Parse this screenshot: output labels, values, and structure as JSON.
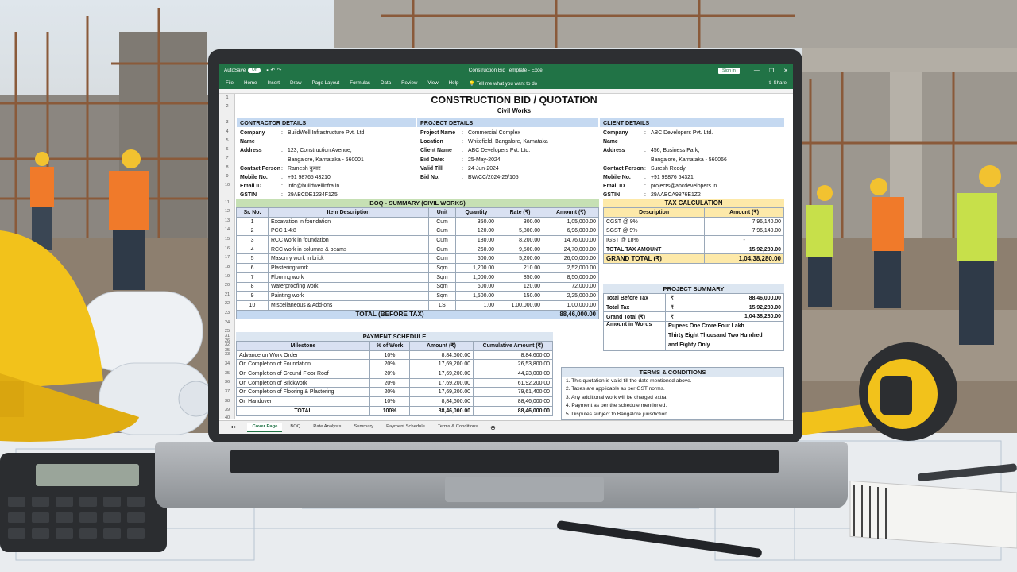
{
  "window": {
    "autosave_label": "AutoSave",
    "autosave_state": "On",
    "title": "Construction Bid Template - Excel",
    "signin_label": "Sign in",
    "minimize": "—",
    "restore": "❐",
    "close": "✕"
  },
  "ribbon": {
    "tabs": [
      "File",
      "Home",
      "Insert",
      "Draw",
      "Page Layout",
      "Formulas",
      "Data",
      "Review",
      "View",
      "Help"
    ],
    "tell_me": "Tell me what you want to do",
    "share": "Share"
  },
  "sheet": {
    "title": "CONSTRUCTION BID / QUOTATION",
    "subtitle": "Civil Works",
    "row_numbers": [
      "1",
      "2",
      "3",
      "4",
      "5",
      "6",
      "7",
      "8",
      "9",
      "10",
      "11",
      "12",
      "13",
      "14",
      "15",
      "16",
      "17",
      "18",
      "19",
      "20",
      "21",
      "22",
      "23",
      "24",
      "25",
      "26",
      "35",
      "31",
      "32",
      "33",
      "34",
      "35",
      "36",
      "37",
      "38",
      "39",
      "40"
    ],
    "contractor": {
      "header": "CONTRACTOR DETAILS",
      "fields": [
        {
          "k": "Company Name",
          "v": "BuildWell Infrastructure Pvt. Ltd."
        },
        {
          "k": "Address",
          "v": "123, Construction Avenue,"
        },
        {
          "k": "",
          "v": "Bangalore, Karnataka - 560001"
        },
        {
          "k": "Contact Person",
          "v": "Ramesh कुमार"
        },
        {
          "k": "Mobile No.",
          "v": "+91 98765 43210"
        },
        {
          "k": "Email ID",
          "v": "info@buildwellinfra.in"
        },
        {
          "k": "GSTIN",
          "v": "29ABCDE1234F1Z5"
        }
      ]
    },
    "project": {
      "header": "PROJECT DETAILS",
      "fields": [
        {
          "k": "Project Name",
          "v": "Commercial Complex"
        },
        {
          "k": "Location",
          "v": "Whitefield, Bangalore, Karnataka"
        },
        {
          "k": "",
          "v": ""
        },
        {
          "k": "Client Name",
          "v": "ABC Developers Pvt. Ltd."
        },
        {
          "k": "Bid Date:",
          "v": "25-May-2024"
        },
        {
          "k": "Valid Till",
          "v": "24-Jun-2024"
        },
        {
          "k": "Bid No.",
          "v": "BW/CC/2024-25/105"
        }
      ]
    },
    "client": {
      "header": "CLIENT DETAILS",
      "fields": [
        {
          "k": "Company Name",
          "v": "ABC Developers Pvt. Ltd."
        },
        {
          "k": "Address",
          "v": "456, Business Park,"
        },
        {
          "k": "",
          "v": "Bangalore, Karnataka - 560066"
        },
        {
          "k": "Contact Person",
          "v": "Suresh Reddy"
        },
        {
          "k": "Mobile No.",
          "v": "+91 99876 54321"
        },
        {
          "k": "Email ID",
          "v": "projects@abcdevelopers.in"
        },
        {
          "k": "GSTIN",
          "v": "29AABCA9876E1Z2"
        }
      ]
    },
    "boq": {
      "header": "BOQ - SUMMARY (CIVIL WORKS)",
      "columns": [
        "Sr. No.",
        "Item Description",
        "Unit",
        "Quantity",
        "Rate (₹)",
        "Amount (₹)"
      ],
      "rows": [
        [
          "1",
          "Excavation in foundation",
          "Cum",
          "350.00",
          "300.00",
          "1,05,000.00"
        ],
        [
          "2",
          "PCC 1:4:8",
          "Cum",
          "120.00",
          "5,800.00",
          "6,96,000.00"
        ],
        [
          "3",
          "RCC work in foundation",
          "Cum",
          "180.00",
          "8,200.00",
          "14,76,000.00"
        ],
        [
          "4",
          "RCC work in columns & beams",
          "Cum",
          "260.00",
          "9,500.00",
          "24,70,000.00"
        ],
        [
          "5",
          "Masonry work in brick",
          "Cum",
          "500.00",
          "5,200.00",
          "26,00,000.00"
        ],
        [
          "6",
          "Plastering work",
          "Sqm",
          "1,200.00",
          "210.00",
          "2,52,000.00"
        ],
        [
          "7",
          "Flooring work",
          "Sqm",
          "1,000.00",
          "850.00",
          "8,50,000.00"
        ],
        [
          "8",
          "Waterproofing work",
          "Sqm",
          "600.00",
          "120.00",
          "72,000.00"
        ],
        [
          "9",
          "Painting work",
          "Sqm",
          "1,500.00",
          "150.00",
          "2,25,000.00"
        ],
        [
          "10",
          "Miscellaneous & Add-ons",
          "LS",
          "1.00",
          "1,00,000.00",
          "1,00,000.00"
        ]
      ],
      "total_label": "TOTAL (BEFORE TAX)",
      "total_value": "88,46,000.00"
    },
    "tax": {
      "header": "TAX CALCULATION",
      "columns": [
        "Description",
        "Amount (₹)"
      ],
      "rows": [
        [
          "CGST @ 9%",
          "7,96,140.00"
        ],
        [
          "SGST @ 9%",
          "7,96,140.00"
        ],
        [
          "IGST @ 18%",
          "-"
        ],
        [
          "TOTAL TAX AMOUNT",
          "15,92,280.00"
        ]
      ],
      "grand_label": "GRAND TOTAL (₹)",
      "grand_value": "1,04,38,280.00"
    },
    "summary": {
      "header": "PROJECT SUMMARY",
      "currency": "₹",
      "rows": [
        [
          "Total Before Tax",
          "88,46,000.00"
        ],
        [
          "Total Tax",
          "15,92,280.00"
        ],
        [
          "Grand Total (₹)",
          "1,04,38,280.00"
        ]
      ],
      "words_label": "Amount in Words",
      "words_lines": [
        "Rupees One Crore Four Lakh",
        "Thirty Eight Thousand Two Hundred",
        "and Eighty Only"
      ]
    },
    "payment": {
      "header": "PAYMENT SCHEDULE",
      "columns": [
        "Milestone",
        "% of Work",
        "Amount (₹)",
        "Cumulative Amount (₹)"
      ],
      "rows": [
        [
          "Advance on Work Order",
          "10%",
          "8,84,600.00",
          "8,84,600.00"
        ],
        [
          "On Completion of Foundation",
          "20%",
          "17,69,200.00",
          "26,53,800.00"
        ],
        [
          "On Completion of Ground Floor Roof",
          "20%",
          "17,69,200.00",
          "44,23,000.00"
        ],
        [
          "On Completion of Brickwork",
          "20%",
          "17,69,200.00",
          "61,92,200.00"
        ],
        [
          "On Completion of Flooring & Plastering",
          "20%",
          "17,69,200.00",
          "79,61,400.00"
        ],
        [
          "On Handover",
          "10%",
          "8,84,600.00",
          "88,46,000.00"
        ]
      ],
      "total_row": [
        "TOTAL",
        "100%",
        "88,46,000.00",
        "88,46,000.00"
      ]
    },
    "terms": {
      "header": "TERMS & CONDITIONS",
      "items": [
        "1.   This quotation is valid till the date mentioned above.",
        "2.   Taxes are applicable as per GST norms.",
        "3.   Any additional work will be charged extra.",
        "4.   Payment as per the schedule mentioned.",
        "5.   Disputes subject to Bangalore jurisdiction."
      ]
    },
    "tabs": [
      "Cover Page",
      "BOQ",
      "Rate Analysis",
      "Summary",
      "Payment Schedule",
      "Terms & Conditions"
    ],
    "add_sheet": "⊕"
  },
  "colors": {
    "excel_green": "#217346",
    "header_blue": "#c5d9f1",
    "header_green": "#c6e0b4",
    "header_yellow": "#fde9a9"
  }
}
